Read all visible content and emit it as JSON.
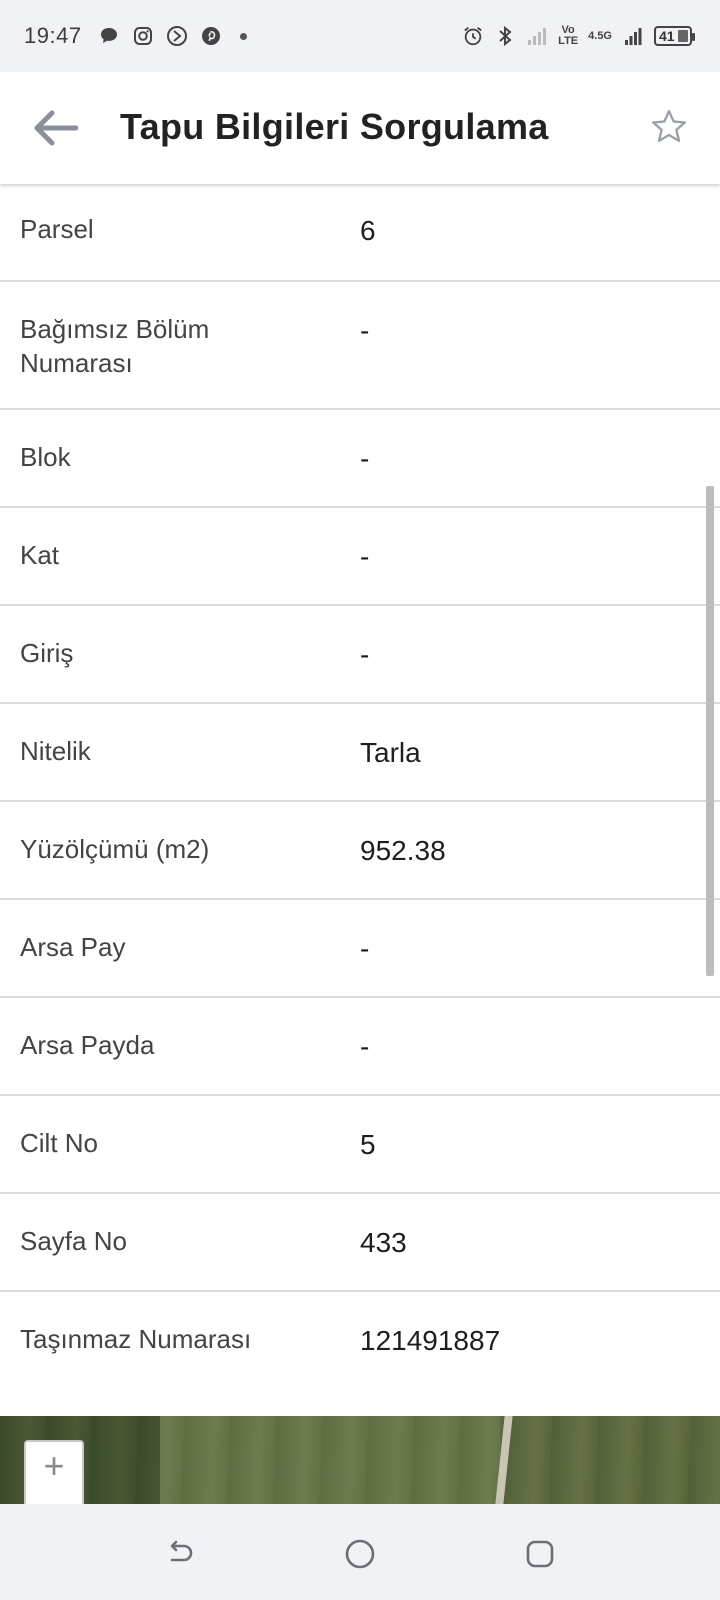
{
  "status_bar": {
    "time": "19:47",
    "left_icons": [
      "chat-bubble-icon",
      "instagram-icon",
      "apps-icon",
      "pinterest-icon"
    ],
    "network_label_top": "Vo",
    "network_label_bottom": "LTE",
    "network_4g": "4.5G",
    "battery": "41"
  },
  "app_bar": {
    "title": "Tapu Bilgileri Sorgulama",
    "back_icon": "arrow-left-icon",
    "favorite_icon": "star-outline-icon"
  },
  "details": [
    {
      "label": "Parsel",
      "value": "6"
    },
    {
      "label": "Bağımsız Bölüm Numarası",
      "value": "-"
    },
    {
      "label": "Blok",
      "value": "-"
    },
    {
      "label": "Kat",
      "value": "-"
    },
    {
      "label": "Giriş",
      "value": "-"
    },
    {
      "label": "Nitelik",
      "value": "Tarla"
    },
    {
      "label": "Yüzölçümü (m2)",
      "value": "952.38"
    },
    {
      "label": "Arsa Pay",
      "value": "-"
    },
    {
      "label": "Arsa Payda",
      "value": "-"
    },
    {
      "label": "Cilt No",
      "value": "5"
    },
    {
      "label": "Sayfa No",
      "value": "433"
    },
    {
      "label": "Taşınmaz Numarası",
      "value": "121491887"
    }
  ],
  "map": {
    "zoom_in_label": "+"
  },
  "nav_bar": {
    "icons": [
      "back-nav-icon",
      "home-nav-icon",
      "recents-nav-icon"
    ]
  },
  "colors": {
    "text_primary": "#222222",
    "text_label": "#444444",
    "divider": "#dcdcdc",
    "system_bar_bg": "#f1f2f6"
  }
}
